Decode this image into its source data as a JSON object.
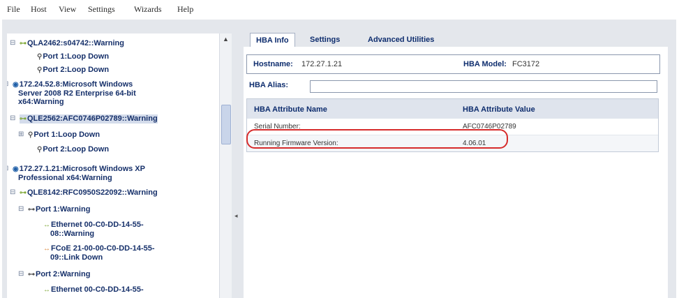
{
  "menu": [
    "File",
    "Host",
    "View",
    "Settings",
    "Wizards",
    "Help"
  ],
  "tree": [
    {
      "text": "QLA2462:s04742::Warning",
      "icon": "hba-icon",
      "glyph": "⊶",
      "exp": "⊟"
    },
    {
      "text": "Port 1:Loop Down",
      "icon": "port-icon",
      "glyph": "⚲"
    },
    {
      "text": "Port 2:Loop Down",
      "icon": "port-icon",
      "glyph": "⚲"
    },
    {
      "text": "172.24.52.8:Microsoft Windows",
      "icon": "host-icon",
      "glyph": "◉",
      "exp": "⊟"
    },
    {
      "text": "Server 2008 R2 Enterprise 64-bit"
    },
    {
      "text": "x64:Warning"
    },
    {
      "text": "QLE2562:AFC0746P02789::Warning",
      "icon": "hba-icon",
      "glyph": "⊶",
      "exp": "⊟"
    },
    {
      "text": "Port 1:Loop Down",
      "icon": "port-icon",
      "glyph": "⚲",
      "exp": "⊞"
    },
    {
      "text": "Port 2:Loop Down",
      "icon": "port-icon",
      "glyph": "⚲"
    },
    {
      "text": "172.27.1.21:Microsoft Windows XP",
      "icon": "host-icon",
      "glyph": "◉",
      "exp": "⊟"
    },
    {
      "text": "Professional x64:Warning"
    },
    {
      "text": "QLE8142:RFC0950S22092::Warning",
      "icon": "hba-icon",
      "glyph": "⊶",
      "exp": "⊟"
    },
    {
      "text": "Port 1:Warning",
      "icon": "port-icon",
      "glyph": "⊶",
      "exp": "⊟"
    },
    {
      "text": "Ethernet 00-C0-DD-14-55-",
      "icon": "ethernet-icon",
      "glyph": "↔"
    },
    {
      "text": "08::Warning"
    },
    {
      "text": "FCoE 21-00-00-C0-DD-14-55-",
      "icon": "fcoe-icon",
      "glyph": "↔"
    },
    {
      "text": "09::Link Down"
    },
    {
      "text": "Port 2:Warning",
      "icon": "port-icon",
      "glyph": "⊶",
      "exp": "⊟"
    },
    {
      "text": "Ethernet 00-C0-DD-14-55-",
      "icon": "ethernet-icon",
      "glyph": "↔"
    }
  ],
  "tabs": [
    "HBA Info",
    "Settings",
    "Advanced Utilities"
  ],
  "hba_info": {
    "hostname_label": "Hostname:",
    "hostname_value": "172.27.1.21",
    "model_label": "HBA Model:",
    "model_value": "FC3172",
    "alias_label": "HBA Alias:",
    "alias_value": ""
  },
  "attributes": {
    "headers": [
      "HBA Attribute Name",
      "HBA Attribute Value"
    ],
    "rows": [
      [
        "Serial Number:",
        "AFC0746P02789"
      ],
      [
        "Running Firmware Version:",
        "4.06.01"
      ]
    ]
  },
  "colors": {
    "highlight": "#d62b2b",
    "accent": "#0e2d6e"
  }
}
